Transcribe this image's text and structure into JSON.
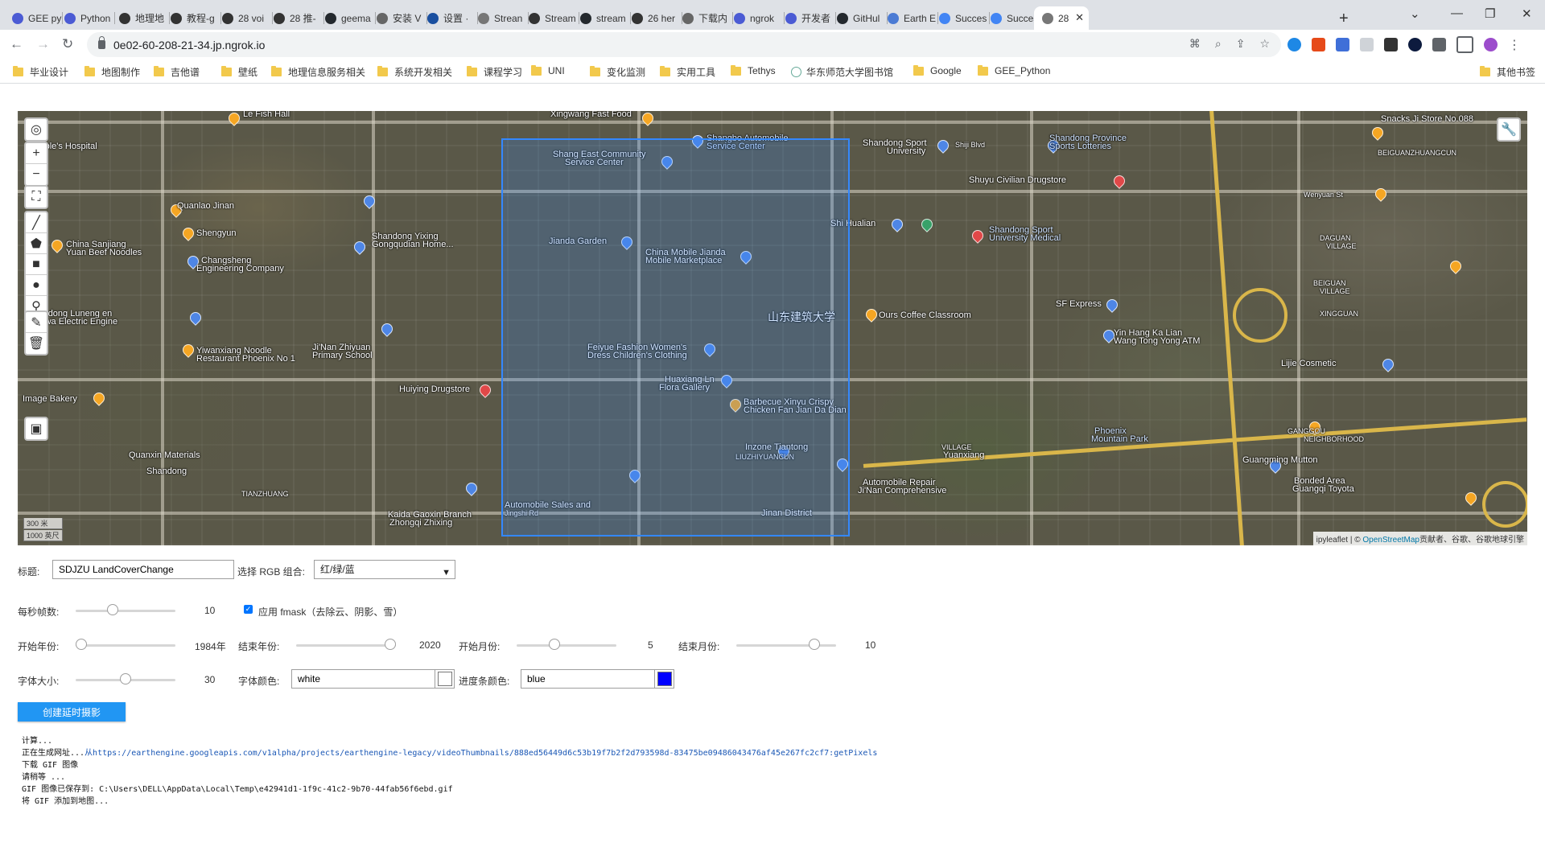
{
  "browser": {
    "tabs": [
      {
        "title": "GEE py",
        "color": "#4b5bd4"
      },
      {
        "title": "Python",
        "color": "#4b5bd4"
      },
      {
        "title": "地理地",
        "color": "#333333"
      },
      {
        "title": "教程-g",
        "color": "#333333"
      },
      {
        "title": "28 voi",
        "color": "#333333"
      },
      {
        "title": "28 推-",
        "color": "#333333"
      },
      {
        "title": "geema",
        "color": "#24292e"
      },
      {
        "title": "安装 V",
        "color": "#666666"
      },
      {
        "title": "设置 ·",
        "color": "#1a4fa0"
      },
      {
        "title": "Strean",
        "color": "#777777"
      },
      {
        "title": "Stream",
        "color": "#333333"
      },
      {
        "title": "stream",
        "color": "#24292e"
      },
      {
        "title": "26 her",
        "color": "#333333"
      },
      {
        "title": "下载内",
        "color": "#666666"
      },
      {
        "title": "ngrok",
        "color": "#4b5bd4"
      },
      {
        "title": "开发者",
        "color": "#4b5bd4"
      },
      {
        "title": "GitHul",
        "color": "#24292e"
      },
      {
        "title": "Earth E",
        "color": "#4b7bd4"
      },
      {
        "title": "Succes",
        "color": "#4285f4"
      },
      {
        "title": "Succes",
        "color": "#4285f4"
      },
      {
        "title": "28",
        "color": "#777777"
      }
    ],
    "url": "0e02-60-208-21-34.jp.ngrok.io",
    "bookmarks": [
      "毕业设计",
      "地图制作",
      "吉他谱",
      "壁纸",
      "地理信息服务相关",
      "系统开发相关",
      "课程学习",
      "UNI",
      "变化监测",
      "实用工具",
      "Tethys",
      "华东师范大学图书馆",
      "Google",
      "GEE_Python"
    ],
    "other_bookmarks": "其他书签"
  },
  "map": {
    "controls": {
      "zoom_in": "+",
      "zoom_out": "−"
    },
    "scale": {
      "metric": "300 米",
      "imperial": "1000 英尺"
    },
    "attribution": {
      "lib": "ipyleaflet",
      "sep": " | © ",
      "link": "OpenStreetMap",
      "rest": "贡献者、谷歌、谷歌地球引擎"
    },
    "labels": [
      {
        "t": "Le Fish Hall",
        "cls": ""
      },
      {
        "t": "Xingwang Fast Food",
        "cls": ""
      },
      {
        "t": "Shangbo Automobile",
        "cls": "blue"
      },
      {
        "t": "Service Center",
        "cls": "blue"
      },
      {
        "t": "Shang East Community",
        "cls": ""
      },
      {
        "t": "Service Center",
        "cls": ""
      },
      {
        "t": "Shandong Sport",
        "cls": ""
      },
      {
        "t": "University",
        "cls": ""
      },
      {
        "t": "Shiji Blvd",
        "cls": "sm"
      },
      {
        "t": "Shandong Province",
        "cls": "blue"
      },
      {
        "t": "Sports Lotteries",
        "cls": "blue"
      },
      {
        "t": "Snacks Ji Store No.088",
        "cls": ""
      },
      {
        "t": "BEIGUANZHUANGCUN",
        "cls": "sm"
      },
      {
        "t": "Shuyu Civilian Drugstore",
        "cls": ""
      },
      {
        "t": "Wenyuan St",
        "cls": "sm"
      },
      {
        "t": "Quanlao Jinan",
        "cls": ""
      },
      {
        "t": "Shengyun",
        "cls": ""
      },
      {
        "t": "Shandong Yixing",
        "cls": ""
      },
      {
        "t": "Gongqudian Home...",
        "cls": ""
      },
      {
        "t": "China Sanjiang",
        "cls": ""
      },
      {
        "t": "Yuan Beef Noodles",
        "cls": ""
      },
      {
        "t": "Changsheng",
        "cls": ""
      },
      {
        "t": "Engineering Company",
        "cls": ""
      },
      {
        "t": "Jianda Garden",
        "cls": ""
      },
      {
        "t": "China Mobile Jianda",
        "cls": ""
      },
      {
        "t": "Mobile Marketplace",
        "cls": ""
      },
      {
        "t": "Shi Hualian",
        "cls": ""
      },
      {
        "t": "Shandong Sport",
        "cls": "blue"
      },
      {
        "t": "University Medical",
        "cls": "blue"
      },
      {
        "t": "DAGUAN",
        "cls": "sm"
      },
      {
        "t": "VILLAGE",
        "cls": "sm"
      },
      {
        "t": "BEIGUAN",
        "cls": "sm"
      },
      {
        "t": "VILLAGE",
        "cls": "sm"
      },
      {
        "t": "XINGGUAN",
        "cls": "sm"
      },
      {
        "t": "Shandong Luneng en",
        "cls": ""
      },
      {
        "t": "Yipawa Electric Engine",
        "cls": ""
      },
      {
        "t": "Ji'Nan Zhiyuan",
        "cls": ""
      },
      {
        "t": "Primary School",
        "cls": ""
      },
      {
        "t": "山东建筑大学",
        "cls": "big"
      },
      {
        "t": "Ours Coffee Classroom",
        "cls": ""
      },
      {
        "t": "SF Express",
        "cls": ""
      },
      {
        "t": "Yin Hang Ka Lian",
        "cls": ""
      },
      {
        "t": "Wang Tong Yong ATM",
        "cls": ""
      },
      {
        "t": "Yiwanxiang Noodle",
        "cls": ""
      },
      {
        "t": "Restaurant Phoenix No 1",
        "cls": ""
      },
      {
        "t": "Feiyue Fashion Women's",
        "cls": ""
      },
      {
        "t": "Dress Children's Clothing",
        "cls": ""
      },
      {
        "t": "Lijie Cosmetic",
        "cls": ""
      },
      {
        "t": "Huaxiang Ln",
        "cls": ""
      },
      {
        "t": "Flora Gallery",
        "cls": ""
      },
      {
        "t": "Huiying Drugstore",
        "cls": ""
      },
      {
        "t": "Image Bakery",
        "cls": ""
      },
      {
        "t": "Barbecue Xinyu Crispy",
        "cls": ""
      },
      {
        "t": "Chicken Fan Jian Da Dian",
        "cls": ""
      },
      {
        "t": "GANGGOU",
        "cls": "sm"
      },
      {
        "t": "NEIGHBORHOOD",
        "cls": "sm"
      },
      {
        "t": "Phoenix",
        "cls": "blue"
      },
      {
        "t": "Mountain Park",
        "cls": "blue"
      },
      {
        "t": "Guangming Mutton",
        "cls": ""
      },
      {
        "t": "Quanxin Materials",
        "cls": ""
      },
      {
        "t": "Shandong",
        "cls": ""
      },
      {
        "t": "Inzone Tiantong",
        "cls": ""
      },
      {
        "t": "LIUZHIYUANCUN",
        "cls": "sm"
      },
      {
        "t": "TIANZHUANG",
        "cls": "sm"
      },
      {
        "t": "VILLAGE",
        "cls": "sm"
      },
      {
        "t": "Yuanxiang",
        "cls": ""
      },
      {
        "t": "Automobile Repair",
        "cls": ""
      },
      {
        "t": "Ji'Nan Comprehensive",
        "cls": ""
      },
      {
        "t": "Bonded Area",
        "cls": ""
      },
      {
        "t": "Guangqi Toyota",
        "cls": ""
      },
      {
        "t": "Kaida Gaoxin Branch",
        "cls": ""
      },
      {
        "t": "Zhongqi Zhixing",
        "cls": ""
      },
      {
        "t": "Automobile Sales and",
        "cls": ""
      },
      {
        "t": "Jingshi Rd",
        "cls": "sm"
      },
      {
        "t": "Jinan District",
        "cls": ""
      },
      {
        "t": "People's Hospital",
        "cls": ""
      }
    ]
  },
  "form": {
    "title_label": "标题:",
    "title_value": "SDJZU LandCoverChange",
    "rgb_label": "选择 RGB 组合:",
    "rgb_value": "红/绿/蓝",
    "fps_label": "每秒帧数:",
    "fps_value": "10",
    "fps_level": 0.35,
    "fmask_label": "应用 fmask（去除云、阴影、雪）",
    "fmask_checked": true,
    "start_year_label": "开始年份:",
    "start_year_value": "1984年",
    "start_year_level": 0.0,
    "end_year_label": "结束年份:",
    "end_year_value": "2020",
    "end_year_level": 1.0,
    "start_month_label": "开始月份:",
    "start_month_value": "5",
    "start_month_level": 0.36,
    "end_month_label": "结束月份:",
    "end_month_value": "10",
    "end_month_level": 0.82,
    "font_size_label": "字体大小:",
    "font_size_value": "30",
    "font_size_level": 0.5,
    "font_color_label": "字体颜色:",
    "font_color_value": "white",
    "font_color_swatch": "#ffffff",
    "progress_color_label": "进度条颜色:",
    "progress_color_value": "blue",
    "progress_color_swatch": "#0000ff",
    "run_button": "创建延时摄影"
  },
  "log": {
    "l1": "计算...",
    "l2_prefix": "正在生成网址...",
    "l2_url": "从https://earthengine.googleapis.com/v1alpha/projects/earthengine-legacy/videoThumbnails/888ed56449d6c53b19f7b2f2d793598d-83475be09486043476af45e267fc2cf7:getPixels",
    "l3": "下载 GIF 图像",
    "l4": "请稍等 ...",
    "l5": "GIF 图像已保存到: C:\\Users\\DELL\\AppData\\Local\\Temp\\e42941d1-1f9c-41c2-9b70-44fab56f6ebd.gif",
    "l6": "将 GIF 添加到地图..."
  }
}
